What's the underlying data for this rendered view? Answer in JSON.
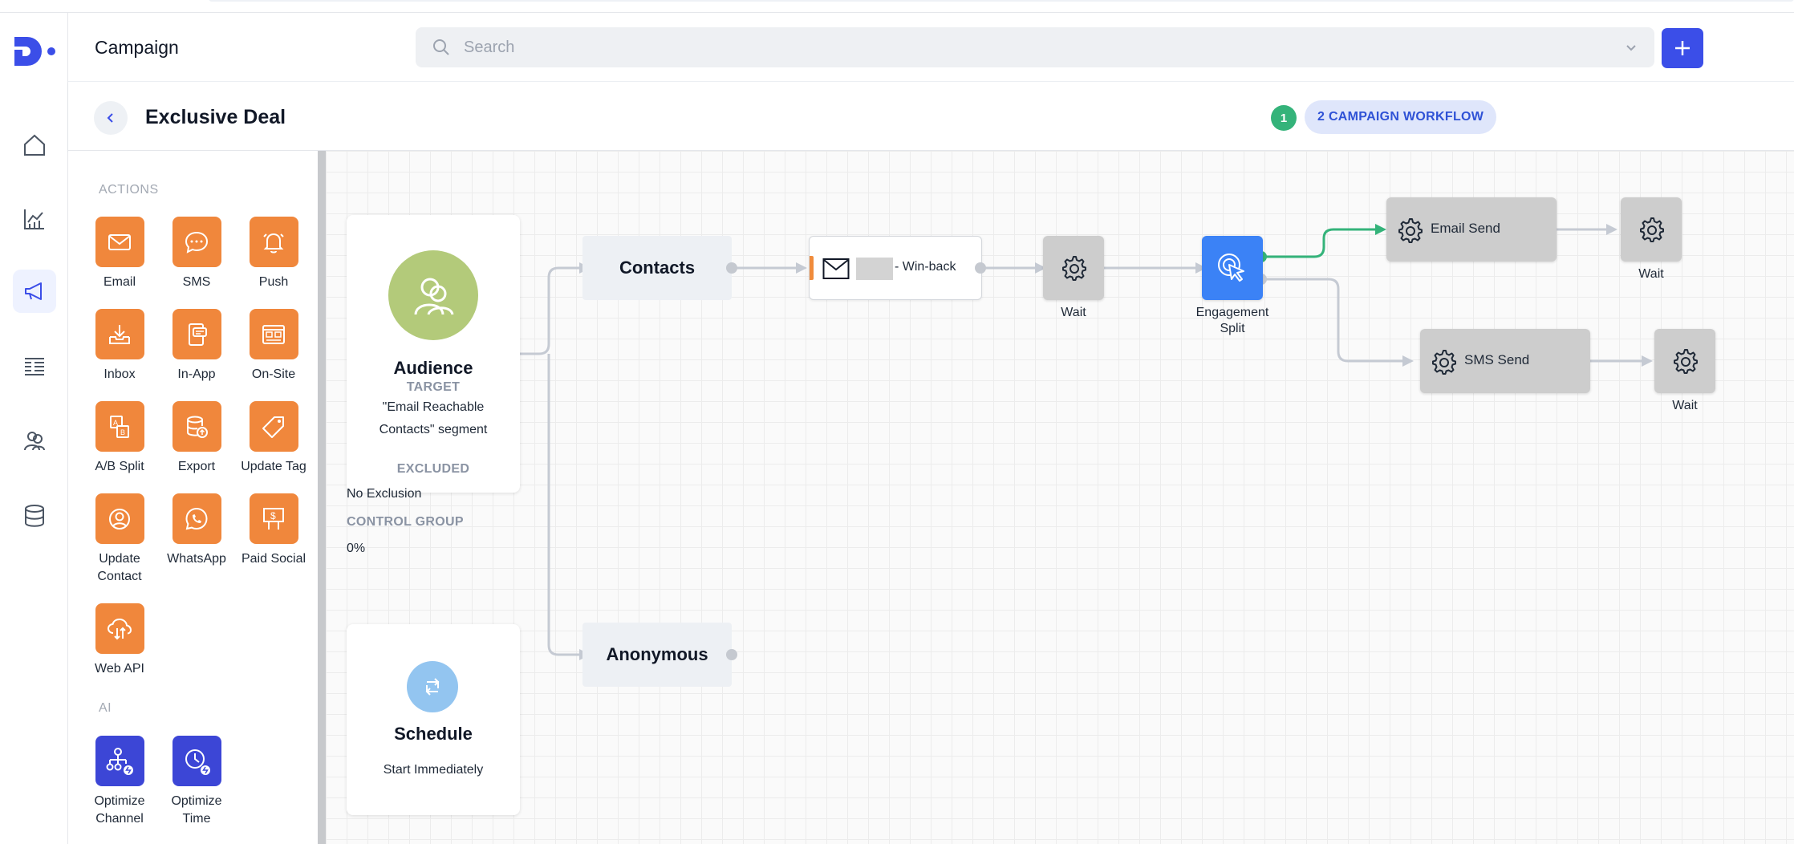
{
  "header": {
    "app_title": "Campaign",
    "search_placeholder": "Search"
  },
  "subheader": {
    "page_title": "Exclusive Deal",
    "step_number": "1",
    "workflow_badge": "2 CAMPAIGN WORKFLOW"
  },
  "panel": {
    "actions_label": "ACTIONS",
    "ai_label": "AI",
    "actions": [
      {
        "label": "Email",
        "icon": "envelope-icon"
      },
      {
        "label": "SMS",
        "icon": "chat-bubble-icon"
      },
      {
        "label": "Push",
        "icon": "bell-icon"
      },
      {
        "label": "Inbox",
        "icon": "inbox-download-icon"
      },
      {
        "label": "In-App",
        "icon": "mobile-message-icon"
      },
      {
        "label": "On-Site",
        "icon": "browser-layout-icon"
      },
      {
        "label": "A/B Split",
        "icon": "ab-split-icon"
      },
      {
        "label": "Export",
        "icon": "database-upload-icon"
      },
      {
        "label": "Update Tag",
        "icon": "tag-icon"
      },
      {
        "label": "Update\nContact",
        "icon": "user-circle-icon"
      },
      {
        "label": "WhatsApp",
        "icon": "whatsapp-icon"
      },
      {
        "label": "Paid Social",
        "icon": "billboard-dollar-icon"
      },
      {
        "label": "Web API",
        "icon": "cloud-api-icon"
      }
    ],
    "ai_actions": [
      {
        "label": "Optimize\nChannel",
        "icon": "channel-tree-icon"
      },
      {
        "label": "Optimize\nTime",
        "icon": "clock-icon"
      }
    ]
  },
  "audience": {
    "title": "Audience",
    "target_label": "TARGET",
    "target_value": "\"Email Reachable Contacts\" segment",
    "excluded_label": "EXCLUDED",
    "excluded_value": "No Exclusion",
    "control_label": "CONTROL GROUP",
    "control_value": "0%"
  },
  "schedule": {
    "title": "Schedule",
    "value": "Start Immediately"
  },
  "nodes": {
    "contacts": "Contacts",
    "anonymous": "Anonymous",
    "email_suffix": "- Win-back",
    "wait1": "Wait",
    "split_label": "Engagement\nSplit",
    "email_send": "Email Send",
    "wait2": "Wait",
    "sms_send": "SMS Send",
    "wait3": "Wait"
  },
  "colors": {
    "accent": "#3b4ee8",
    "action_tile": "#f0873c",
    "ai_tile": "#3c46d6",
    "split_node": "#3b82f6",
    "active_path": "#34b37a",
    "audience_circle": "#b3ca7a",
    "schedule_circle": "#93c5f0"
  }
}
